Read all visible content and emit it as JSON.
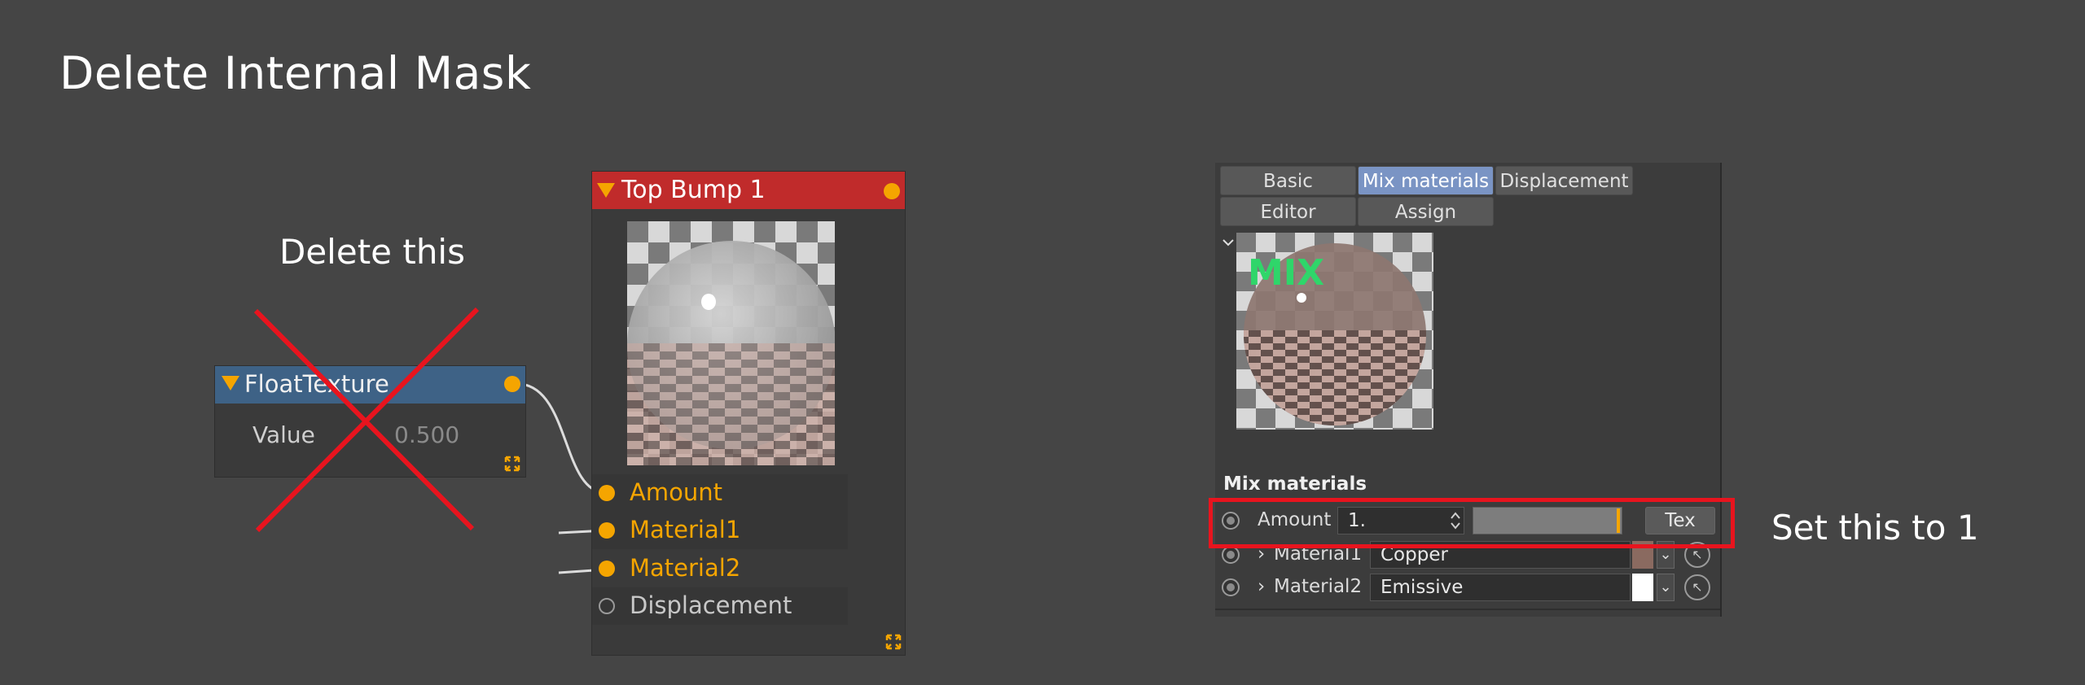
{
  "title": "Delete Internal Mask",
  "annotations": {
    "delete_note": "Delete this",
    "set_note": "Set this to 1"
  },
  "float_texture_node": {
    "title": "FloatTexture",
    "value_label": "Value",
    "value": "0.500"
  },
  "top_bump_node": {
    "title": "Top Bump 1",
    "pins": [
      "Amount",
      "Material1",
      "Material2",
      "Displacement"
    ]
  },
  "panel": {
    "tabs": [
      "Basic",
      "Mix materials",
      "Displacement",
      "Editor",
      "Assign"
    ],
    "active_tab": "Mix materials",
    "preview_text": "MIX",
    "section_title": "Mix materials",
    "amount": {
      "label": "Amount",
      "value": "1.",
      "tex_label": "Tex"
    },
    "material1": {
      "label": "Material1",
      "value": "Copper"
    },
    "material2": {
      "label": "Material2",
      "value": "Emissive"
    }
  },
  "colors": {
    "background": "#454545",
    "pin_orange": "#f5a500",
    "float_header": "#3e6286",
    "bump_header": "#c02b2b",
    "cross_red": "#e8141e",
    "active_tab": "#7a94c4"
  }
}
